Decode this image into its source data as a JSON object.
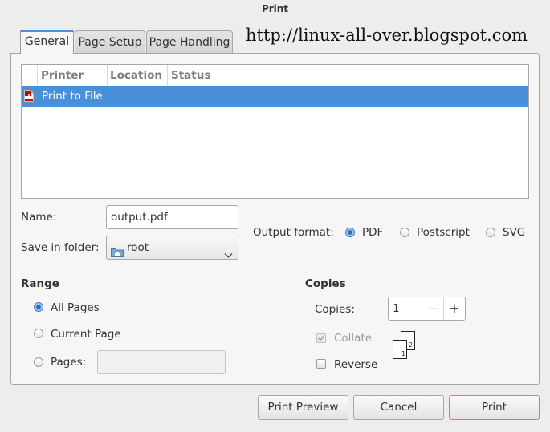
{
  "window": {
    "title": "Print"
  },
  "tabs": [
    {
      "label": "General",
      "active": true
    },
    {
      "label": "Page Setup",
      "active": false
    },
    {
      "label": "Page Handling",
      "active": false
    }
  ],
  "watermark": "http://linux-all-over.blogspot.com",
  "printer_list": {
    "columns": [
      "Printer",
      "Location",
      "Status"
    ],
    "rows": [
      {
        "icon": "pdf-file-icon",
        "printer": "Print to File",
        "location": "",
        "status": "",
        "selected": true
      }
    ]
  },
  "file": {
    "name_label": "Name:",
    "name_value": "output.pdf",
    "folder_label": "Save in folder:",
    "folder_value": "root",
    "folder_icon": "home-folder-icon"
  },
  "output_format": {
    "label": "Output format:",
    "options": [
      "PDF",
      "Postscript",
      "SVG"
    ],
    "selected": "PDF"
  },
  "range": {
    "heading": "Range",
    "options": [
      "All Pages",
      "Current Page",
      "Pages:"
    ],
    "selected": "All Pages",
    "pages_value": ""
  },
  "copies": {
    "heading": "Copies",
    "copies_label": "Copies:",
    "copies_value": "1",
    "minus": "−",
    "plus": "+",
    "collate_label": "Collate",
    "collate_checked": true,
    "collate_enabled": false,
    "reverse_label": "Reverse",
    "reverse_checked": false,
    "collate_page_numbers": [
      "1",
      "2"
    ]
  },
  "buttons": {
    "preview": "Print Preview",
    "cancel": "Cancel",
    "print": "Print"
  },
  "colors": {
    "accent": "#4a90d9"
  }
}
